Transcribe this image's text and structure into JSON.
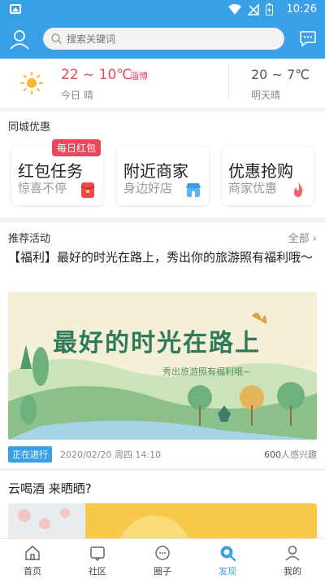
{
  "status_bar": {
    "time": "10:26"
  },
  "header": {
    "search_placeholder": "搜索关键词"
  },
  "weather": {
    "today_temp": "22 ~ 10℃",
    "city": "淄博",
    "today_label": "今日 晴",
    "tomorrow_temp": "20 ~ 7℃",
    "tomorrow_label": "明天晴"
  },
  "deals": {
    "title": "同城优惠",
    "badge": "每日红包",
    "cards": [
      {
        "title": "红包任务",
        "subtitle": "惊喜不停",
        "icon": "red-envelope-icon"
      },
      {
        "title": "附近商家",
        "subtitle": "身边好店",
        "icon": "shop-icon"
      },
      {
        "title": "优惠抢购",
        "subtitle": "商家优惠",
        "icon": "flame-icon"
      }
    ]
  },
  "recommend": {
    "title": "推荐活动",
    "all_label": "全部",
    "headline": "【福利】最好的时光在路上，秀出你的旅游照有福利哦～",
    "banner_title": "最好的时光在路上",
    "banner_subtitle": "秀出旅游照有福利哦~",
    "status": "正在进行",
    "date": "2020/02/20 周四 14:10",
    "interest_count": "600",
    "interest_suffix": "人感兴趣"
  },
  "post": {
    "title": "云喝酒 来晒晒?"
  },
  "tabbar": {
    "tabs": [
      {
        "label": "首页",
        "icon": "home-icon"
      },
      {
        "label": "社区",
        "icon": "community-icon"
      },
      {
        "label": "圈子",
        "icon": "circle-icon"
      },
      {
        "label": "发现",
        "icon": "discover-icon",
        "active": true
      },
      {
        "label": "我的",
        "icon": "profile-icon"
      }
    ]
  },
  "colors": {
    "brand": "#3aa0e6",
    "accent_red": "#e9485a"
  }
}
